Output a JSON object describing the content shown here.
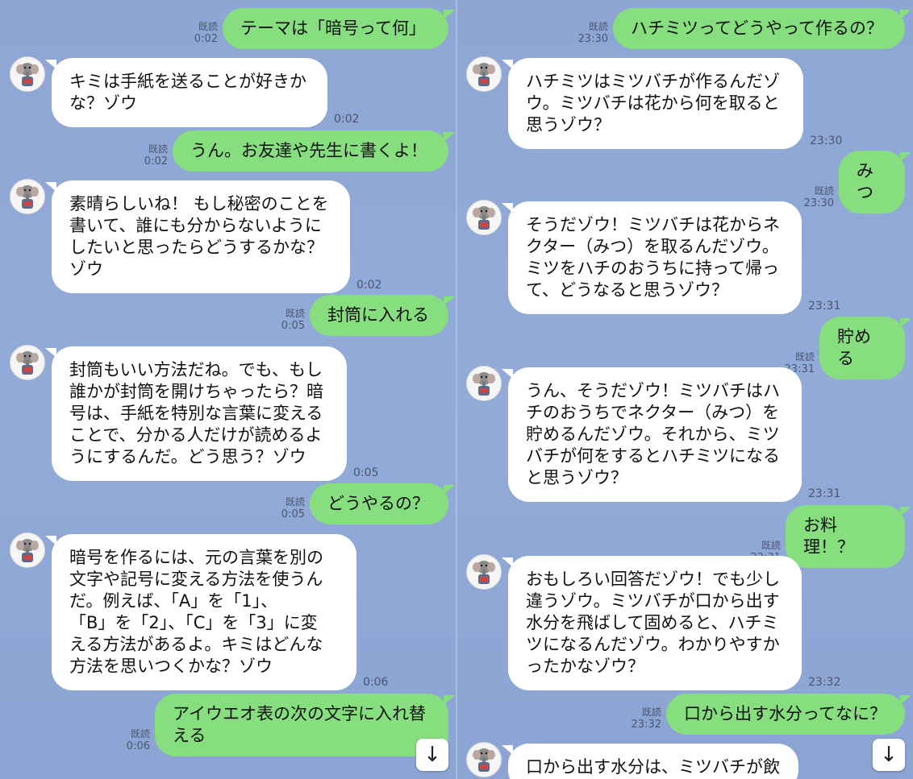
{
  "read_label": "既読",
  "left": [
    {
      "dir": "out",
      "text": "テーマは「暗号って何」",
      "time": "0:02"
    },
    {
      "dir": "in",
      "text": "キミは手紙を送ることが好きか\nな？ゾウ",
      "time": "0:02"
    },
    {
      "dir": "out",
      "text": "うん。お友達や先生に書くよ！",
      "time": "0:02"
    },
    {
      "dir": "in",
      "text": "素晴らしいね！ もし秘密のことを\n書いて、誰にも分からないように\nしたいと思ったらどうするかな？\nゾウ",
      "time": "0:02"
    },
    {
      "dir": "out",
      "text": "封筒に入れる",
      "time": "0:05"
    },
    {
      "dir": "in",
      "text": "封筒もいい方法だね。でも、もし\n誰かが封筒を開けちゃったら？暗\n号は、手紙を特別な言葉に変える\nことで、分かる人だけが読めるよ\nうにするんだ。どう思う？ゾウ",
      "time": "0:05"
    },
    {
      "dir": "out",
      "text": "どうやるの？",
      "time": "0:05"
    },
    {
      "dir": "in",
      "text": "暗号を作るには、元の言葉を別の\n文字や記号に変える方法を使うん\nだ。例えば、「A」を「1」、\n「B」を「2」、「C」を「3」に変\nえる方法があるよ。キミはどんな\n方法を思いつくかな？ゾウ",
      "time": "0:06"
    },
    {
      "dir": "out",
      "text": "アイウエオ表の次の文字に入れ替\nえる",
      "time": "0:06"
    }
  ],
  "right": [
    {
      "dir": "out",
      "text": "ハチミツってどうやって作るの？",
      "time": "23:30"
    },
    {
      "dir": "in",
      "text": "ハチミツはミツバチが作るんだゾ\nウ。ミツバチは花から何を取ると\n思うゾウ？",
      "time": "23:30"
    },
    {
      "dir": "out",
      "text": "みつ",
      "time": "23:30"
    },
    {
      "dir": "in",
      "text": "そうだゾウ！ミツバチは花からネ\nクター（みつ）を取るんだゾウ。\nミツをハチのおうちに持って帰っ\nて、どうなると思うゾウ？",
      "time": "23:31"
    },
    {
      "dir": "out",
      "text": "貯める",
      "time": "23:31"
    },
    {
      "dir": "in",
      "text": "うん、そうだゾウ！ミツバチはハ\nチのおうちでネクター（みつ）を\n貯めるんだゾウ。それから、ミツ\nバチが何をするとハチミツになる\nと思うゾウ？",
      "time": "23:31"
    },
    {
      "dir": "out",
      "text": "お料理！？",
      "time": "23:31"
    },
    {
      "dir": "in",
      "text": "おもしろい回答だゾウ！でも少し\n違うゾウ。ミツバチが口から出す\n水分を飛ばして固めると、ハチミ\nツになるんだゾウ。わかりやすか\nったかなゾウ？",
      "time": "23:32"
    },
    {
      "dir": "out",
      "text": "口から出す水分ってなに？",
      "time": "23:32"
    },
    {
      "dir": "in",
      "text": "口から出す水分は、ミツバチが飲",
      "time": ""
    }
  ],
  "scroll_icon": "arrow-down-icon",
  "colors": {
    "out_bubble": "#86de7f",
    "in_bubble": "#ffffff",
    "background": "#8fa8d6"
  }
}
